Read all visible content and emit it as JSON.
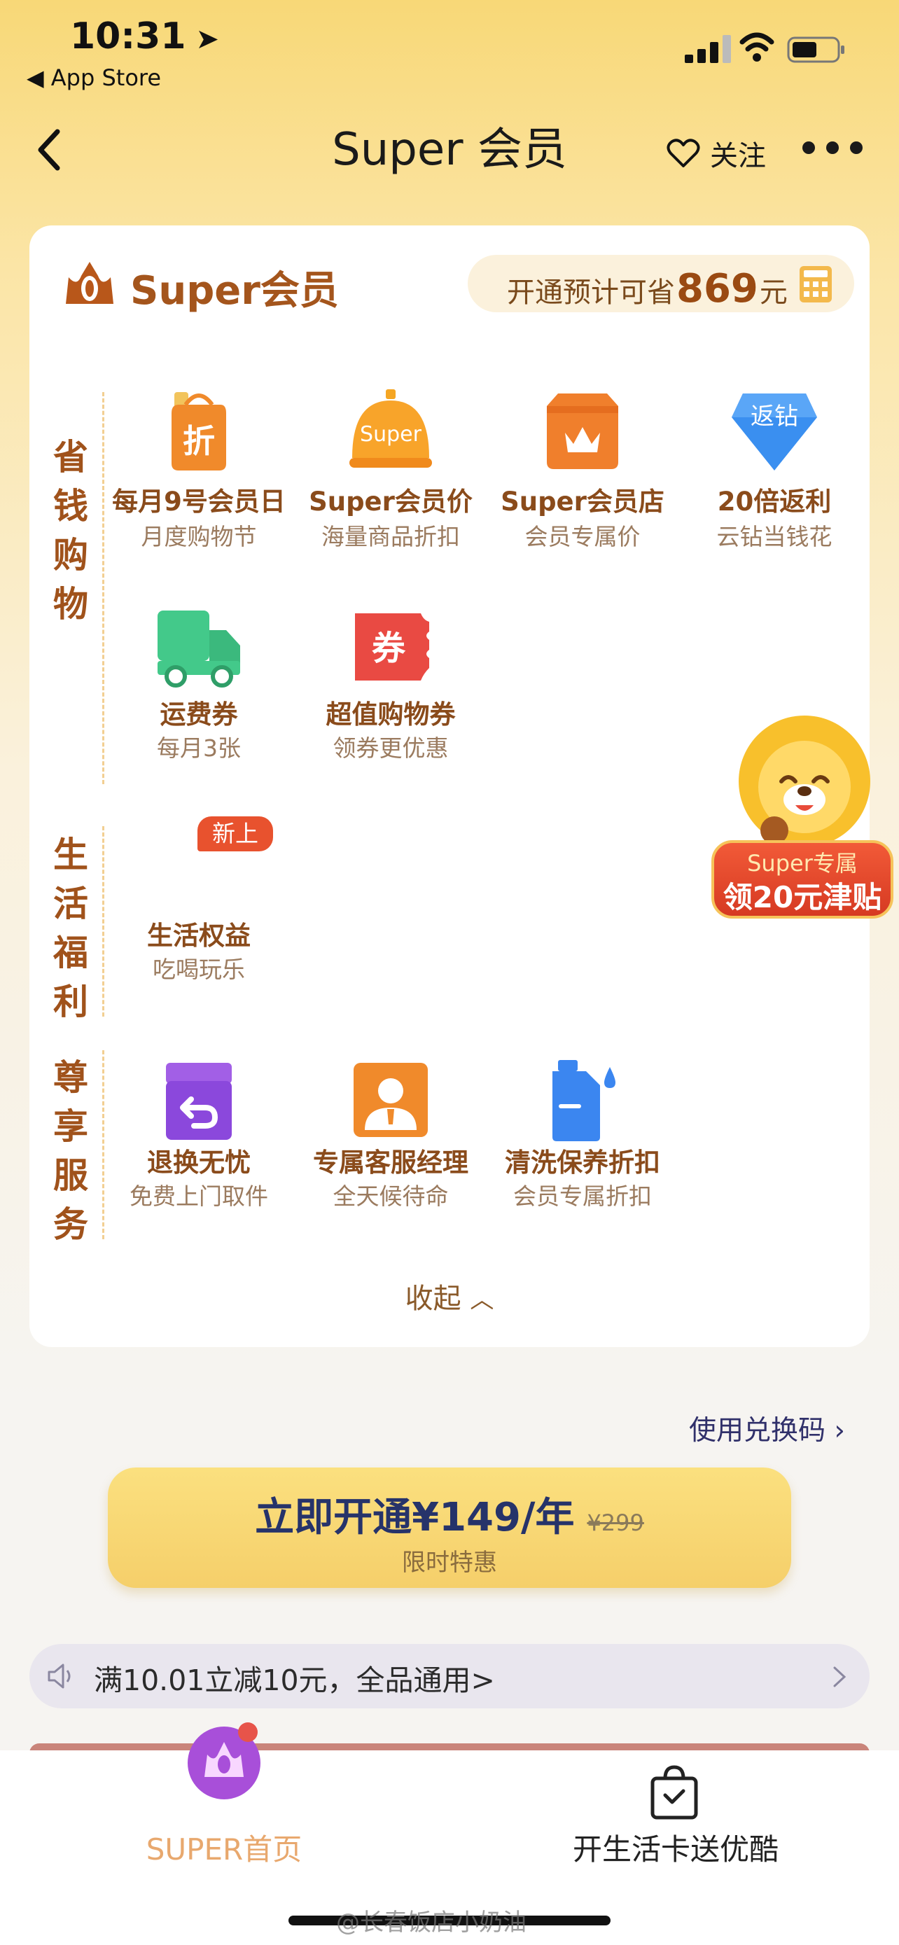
{
  "status": {
    "time": "10:31",
    "back_app": "◀ App Store"
  },
  "nav": {
    "title": "Super 会员",
    "follow": "关注"
  },
  "card": {
    "title": "Super会员",
    "save_prefix": "开通预计可省",
    "save_amount": "869",
    "save_suffix": "元",
    "categories": [
      {
        "label": "省钱购物",
        "items": [
          {
            "label": "每月9号会员日",
            "sub": "月度购物节",
            "icon": "discount-bag-icon"
          },
          {
            "label": "Super会员价",
            "sub": "海量商品折扣",
            "icon": "super-price-icon",
            "icon_text": "Super"
          },
          {
            "label": "Super会员店",
            "sub": "会员专属价",
            "icon": "member-store-icon"
          },
          {
            "label": "20倍返利",
            "sub": "云钻当钱花",
            "icon": "rebate-diamond-icon",
            "icon_text": "返钻"
          },
          {
            "label": "运费券",
            "sub": "每月3张",
            "icon": "delivery-truck-icon"
          },
          {
            "label": "超值购物券",
            "sub": "领券更优惠",
            "icon": "coupon-icon",
            "icon_text": "券"
          }
        ]
      },
      {
        "label": "生活福利",
        "items": [
          {
            "label": "生活权益",
            "sub": "吃喝玩乐",
            "badge": "新上"
          }
        ]
      },
      {
        "label": "尊享服务",
        "items": [
          {
            "label": "退换无忧",
            "sub": "免费上门取件",
            "icon": "return-box-icon"
          },
          {
            "label": "专属客服经理",
            "sub": "全天候待命",
            "icon": "service-manager-icon"
          },
          {
            "label": "清洗保养折扣",
            "sub": "会员专属折扣",
            "icon": "cleaning-bottle-icon"
          }
        ]
      }
    ],
    "discount_icon_text": "折",
    "collapse": "收起"
  },
  "promo": {
    "line1": "Super专属",
    "line2": "领20元津贴"
  },
  "redeem": "使用兑换码",
  "cta": {
    "main": "立即开通¥149/年",
    "old": "¥299",
    "sub": "限时特惠"
  },
  "notice": "满10.01立减10元，全品通用>",
  "tabs": [
    {
      "label": "SUPER首页"
    },
    {
      "label": "开生活卡送优酷"
    }
  ],
  "watermark": "@长春饭店小奶油",
  "colors": {
    "accent": "#a4551c",
    "cta": "#f8d877",
    "tab_active": "#e8a86e"
  }
}
